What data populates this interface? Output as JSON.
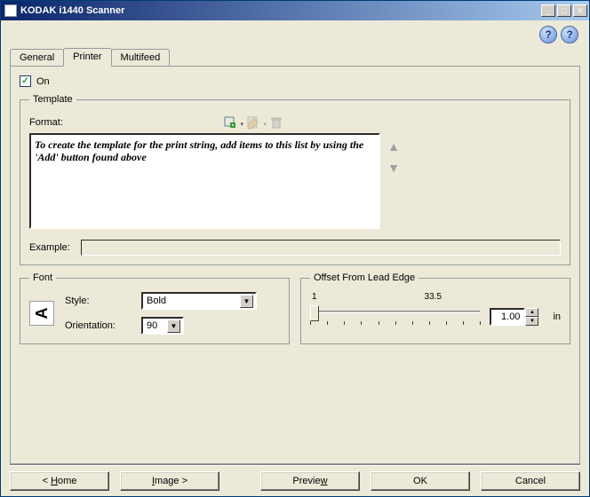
{
  "window": {
    "title": "KODAK i1440 Scanner"
  },
  "tabs": {
    "general": "General",
    "printer": "Printer",
    "multifeed": "Multifeed",
    "active": "printer"
  },
  "checkbox": {
    "on_label": "On",
    "checked": true
  },
  "template": {
    "legend": "Template",
    "format_label": "Format:",
    "list_hint": "To create the template for the print string, add items to this list by using the 'Add' button found above",
    "example_label": "Example:",
    "example_value": ""
  },
  "font": {
    "legend": "Font",
    "style_label": "Style:",
    "style_value": "Bold",
    "orientation_label": "Orientation:",
    "orientation_value": "90",
    "icon_glyph": "A"
  },
  "offset": {
    "legend": "Offset From Lead Edge",
    "min": "1",
    "max": "33.5",
    "value": "1.00",
    "unit": "in"
  },
  "buttons": {
    "home": "< Home",
    "image": "Image >",
    "preview": "Preview",
    "ok": "OK",
    "cancel": "Cancel"
  },
  "icons": {
    "add": "add-icon",
    "edit": "edit-icon",
    "delete": "delete-trash-icon",
    "up": "arrow-up-icon",
    "down": "arrow-down-icon",
    "help1": "help-globe-icon",
    "help2": "help-question-icon"
  }
}
